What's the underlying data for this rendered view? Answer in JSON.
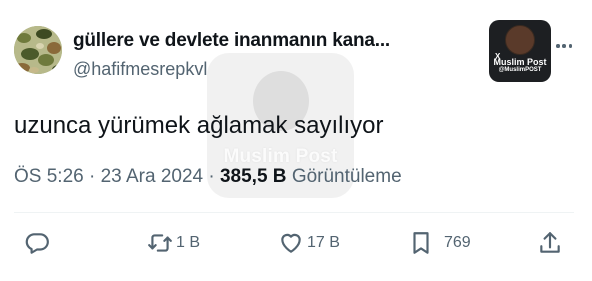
{
  "tweet": {
    "display_name": "güllere ve devlete inanmanın kana...",
    "handle": "@hafifmesrepkvl",
    "text": "uzunca yürümek ağlamak sayılıyor",
    "time": "ÖS 5:26",
    "date": "23 Ara 2024",
    "separator": "·",
    "views_count": "385,5 B",
    "views_label": "Görüntüleme"
  },
  "badge": {
    "title": "Muslim Post",
    "handle": "@MuslimPOST",
    "x_mark": "X"
  },
  "watermark": {
    "text": "Muslim Post"
  },
  "actions": {
    "reply": {
      "icon": "reply-icon",
      "count": ""
    },
    "retweet": {
      "icon": "retweet-icon",
      "count": "1 B"
    },
    "like": {
      "icon": "heart-icon",
      "count": "17 B"
    },
    "bookmark": {
      "icon": "bookmark-icon",
      "count": "769"
    },
    "share": {
      "icon": "share-icon",
      "count": ""
    }
  },
  "colors": {
    "text_primary": "#0f1419",
    "text_secondary": "#536471",
    "divider": "#eff3f4"
  }
}
